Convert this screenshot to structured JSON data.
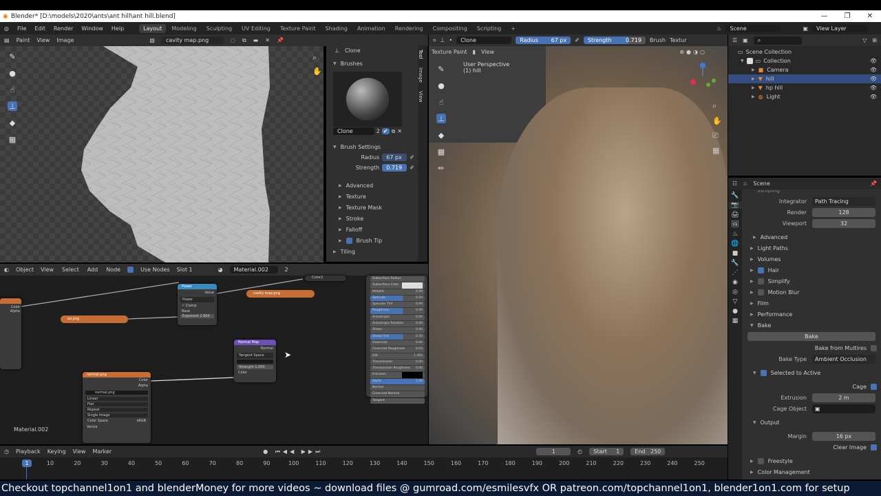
{
  "window": {
    "title": "Blender* [D:\\models\\2020\\ants\\ant hill\\ant hill.blend]",
    "minimize": "—",
    "maximize": "❐",
    "close": "✕"
  },
  "menu": {
    "items": [
      "File",
      "Edit",
      "Render",
      "Window",
      "Help"
    ],
    "workspaces": [
      "Layout",
      "Modeling",
      "Sculpting",
      "UV Editing",
      "Texture Paint",
      "Shading",
      "Animation",
      "Rendering",
      "Compositing",
      "Scripting",
      "+"
    ],
    "scene": "Scene",
    "view_layer": "View Layer"
  },
  "image_editor": {
    "mode": "Paint",
    "view": "View",
    "image": "Image",
    "image_name": "cavity map.png"
  },
  "npanel": {
    "tool": "Clone",
    "brushes": "Brushes",
    "brush_name": "Clone",
    "brush_users": "2",
    "brush_settings": "Brush Settings",
    "radius_label": "Radius",
    "radius": "67 px",
    "strength_label": "Strength",
    "strength": "0.719",
    "subpanels": [
      "Advanced",
      "Texture",
      "Texture Mask",
      "Stroke",
      "Falloff"
    ],
    "brush_tip": "Brush Tip",
    "tiling": "Tiling",
    "tabs": [
      "Tool",
      "Image",
      "View"
    ]
  },
  "node_editor": {
    "object": "Object",
    "menus": [
      "View",
      "Select",
      "Add",
      "Node"
    ],
    "use_nodes": "Use Nodes",
    "slot": "Slot 1",
    "material": "Material.002",
    "users": "2",
    "footer_material": "Material.002",
    "power_node": {
      "title": "Power",
      "value": "Value",
      "op": "Power",
      "clamp": "Clamp",
      "base": "Base",
      "exponent": "Exponent",
      "exp_val": "2.900"
    },
    "cavity_node": "cavity map.png",
    "ao_node": "ao.png",
    "color2": "Color2",
    "normal_map_node": {
      "title": "Normal Map",
      "normal": "Normal",
      "space": "Tangent Space",
      "strength": "Strength",
      "strength_val": "1.000",
      "color": "Color"
    },
    "normal_img_node": {
      "title": "normal.png",
      "color": "Color",
      "alpha": "Alpha",
      "file": "normal.png",
      "interp": "Linear",
      "proj": "Flat",
      "ext": "Repeat",
      "source": "Single Image",
      "cs_label": "Color Space",
      "cs": "sRGB",
      "vector": "Vector"
    },
    "left_node": {
      "color": "Color",
      "alpha": "Alpha"
    },
    "bsdf": [
      [
        "Subsurface Radius",
        ""
      ],
      [
        "Subsurface Color",
        ""
      ],
      [
        "Metallic",
        "0.00"
      ],
      [
        "Specular",
        "0.50"
      ],
      [
        "Specular Tint",
        "0.00"
      ],
      [
        "Roughness",
        "0.50"
      ],
      [
        "Anisotropic",
        "0.00"
      ],
      [
        "Anisotropic Rotation",
        "0.00"
      ],
      [
        "Sheen",
        "0.00"
      ],
      [
        "Sheen Tint",
        "0.50"
      ],
      [
        "Clearcoat",
        "0.00"
      ],
      [
        "Clearcoat Roughness",
        "0.03"
      ],
      [
        "IOR",
        "1.450"
      ],
      [
        "Transmission",
        "0.00"
      ],
      [
        "Transmission Roughness",
        "0.00"
      ],
      [
        "Emission",
        ""
      ],
      [
        "Alpha",
        "1.00"
      ],
      [
        "Normal",
        ""
      ],
      [
        "Clearcoat Normal",
        ""
      ],
      [
        "Tangent",
        ""
      ]
    ]
  },
  "viewport": {
    "tool": "Clone",
    "radius_label": "Radius",
    "radius": "67 px",
    "strength_label": "Strength",
    "strength": "0.719",
    "brush": "Brush",
    "texture": "Textur",
    "mode": "Texture Paint",
    "view": "View",
    "perspective": "User Perspective",
    "object": "(1) hill"
  },
  "outliner": {
    "root": "Scene Collection",
    "collection": "Collection",
    "items": [
      {
        "name": "Camera",
        "color": "#e08a3c"
      },
      {
        "name": "hill",
        "color": "#e08a3c"
      },
      {
        "name": "hp hill",
        "color": "#e08a3c"
      },
      {
        "name": "Light",
        "color": "#e08a3c"
      }
    ]
  },
  "properties": {
    "scene": "Scene",
    "sampling": "Sampling",
    "integrator_label": "Integrator",
    "integrator": "Path Tracing",
    "render_label": "Render",
    "render": "128",
    "viewport_label": "Viewport",
    "viewport": "32",
    "advanced": "Advanced",
    "sections": [
      {
        "label": "Light Paths",
        "check": null
      },
      {
        "label": "Volumes",
        "check": null
      },
      {
        "label": "Hair",
        "check": true
      },
      {
        "label": "Simplify",
        "check": false
      },
      {
        "label": "Motion Blur",
        "check": false
      },
      {
        "label": "Film",
        "check": null
      },
      {
        "label": "Performance",
        "check": null
      }
    ],
    "bake": "Bake",
    "bake_button": "Bake",
    "bake_multires": "Bake from Multires",
    "bake_type_label": "Bake Type",
    "bake_type": "Ambient Occlusion",
    "selected_to_active": "Selected to Active",
    "cage": "Cage",
    "extrusion_label": "Extrusion",
    "extrusion": "2 m",
    "cage_object": "Cage Object",
    "output": "Output",
    "margin_label": "Margin",
    "margin": "16 px",
    "clear_image": "Clear Image",
    "freestyle": "Freestyle",
    "color_management": "Color Management"
  },
  "timeline": {
    "playback": "Playback",
    "keying": "Keying",
    "view": "View",
    "marker": "Marker",
    "current": "1",
    "start_label": "Start",
    "start": "1",
    "end_label": "End",
    "end": "250",
    "ticks": [
      "10",
      "20",
      "30",
      "40",
      "50",
      "60",
      "70",
      "80",
      "90",
      "100",
      "110",
      "120",
      "130",
      "140",
      "150",
      "160",
      "170",
      "180",
      "190",
      "200",
      "210",
      "220",
      "230",
      "240",
      "250"
    ]
  },
  "banner": "Checkout topchannel1on1 and blenderMoney for more videos ~ download files @ gumroad.com/esmilesvfx OR patreon.com/topchannel1on1, blender1on1.com for setup",
  "colors": {
    "accent": "#4772b3",
    "node_orange": "#c56d33",
    "banner_bg": "#0c1a33"
  }
}
